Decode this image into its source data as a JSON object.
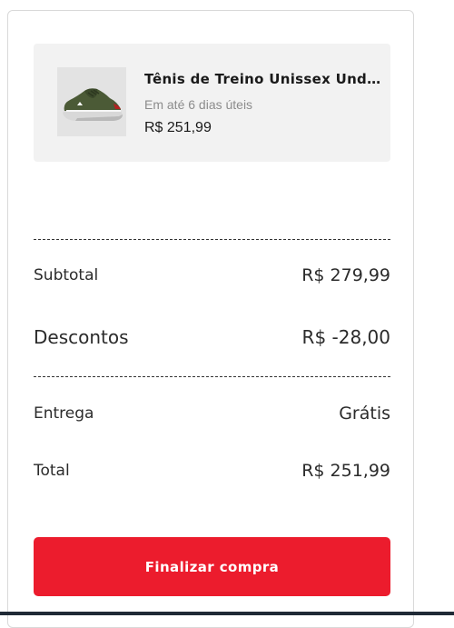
{
  "cart": {
    "product": {
      "name": "Tênis de Treino Unissex Under Armour",
      "delivery": "Em até 6 dias úteis",
      "price": "R$ 251,99",
      "image_icon": "sneaker-icon"
    },
    "summary": {
      "subtotal_label": "Subtotal",
      "subtotal_value": "R$ 279,99",
      "discount_label": "Descontos",
      "discount_value": "R$ -28,00",
      "shipping_label": "Entrega",
      "shipping_value": "Grátis",
      "total_label": "Total",
      "total_value": "R$ 251,99"
    },
    "checkout_button": "Finalizar compra"
  },
  "colors": {
    "accent": "#ec1c2d",
    "card_bg": "#f2f2f2",
    "text": "#2b2b2b"
  }
}
